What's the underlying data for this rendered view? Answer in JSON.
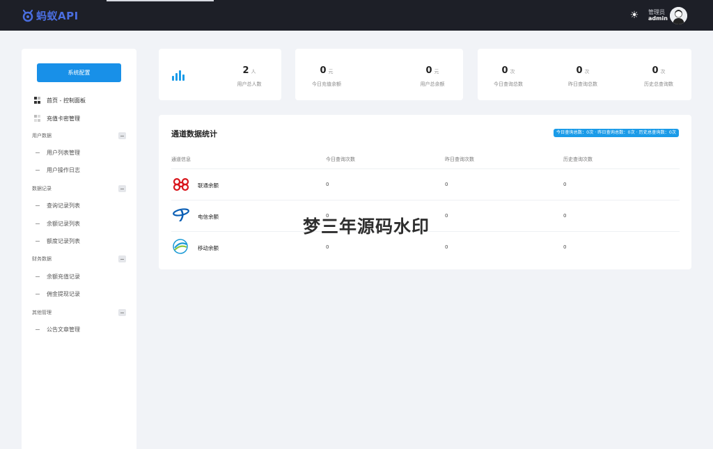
{
  "header": {
    "logo_text": "蚂蚁API",
    "user_role": "管理员",
    "user_name": "admin"
  },
  "sidebar": {
    "config_button": "系统配置",
    "top_items": [
      {
        "label": "首页 - 控制面板",
        "icon": "dashboard-icon",
        "active": true
      },
      {
        "label": "充值卡密管理",
        "icon": "card-icon",
        "active": false
      }
    ],
    "groups": [
      {
        "label": "用户数据",
        "items": [
          "用户列表管理",
          "用户操作日志"
        ]
      },
      {
        "label": "数据记录",
        "items": [
          "查询记录列表",
          "余额记录列表",
          "额度记录列表"
        ]
      },
      {
        "label": "财务数据",
        "items": [
          "余额充值记录",
          "佣金提现记录"
        ]
      },
      {
        "label": "其他管理",
        "items": [
          "公告文章管理"
        ]
      }
    ]
  },
  "stats": {
    "users": {
      "value": "2",
      "unit": "人",
      "label": "用户总人数"
    },
    "today_recharge": {
      "value": "0",
      "unit": "元",
      "label": "今日充值余额"
    },
    "user_balance": {
      "value": "0",
      "unit": "元",
      "label": "用户总余额"
    },
    "today_queries": {
      "value": "0",
      "unit": "次",
      "label": "今日查询总数"
    },
    "yesterday_queries": {
      "value": "0",
      "unit": "次",
      "label": "昨日查询总数"
    },
    "history_queries": {
      "value": "0",
      "unit": "次",
      "label": "历史总查询数"
    }
  },
  "channel_panel": {
    "title": "通道数据统计",
    "badge": "今日查询总数：0次 · 昨日查询总数：0次 · 历史总查询数：0次",
    "columns": [
      "通道信息",
      "今日查询次数",
      "昨日查询次数",
      "历史查询次数"
    ],
    "rows": [
      {
        "name": "联通余额",
        "logo": "china-unicom-logo",
        "today": "0",
        "yesterday": "0",
        "history": "0"
      },
      {
        "name": "电信余额",
        "logo": "china-telecom-logo",
        "today": "0",
        "yesterday": "0",
        "history": "0"
      },
      {
        "name": "移动余额",
        "logo": "china-mobile-logo",
        "today": "0",
        "yesterday": "0",
        "history": "0"
      }
    ]
  },
  "watermark": "梦三年源码水印",
  "colors": {
    "topbar": "#1d1f27",
    "brand": "#4a6ee0",
    "primary": "#1890e8",
    "bar_chart": "#1a9be8",
    "background": "#f1f3f7"
  }
}
